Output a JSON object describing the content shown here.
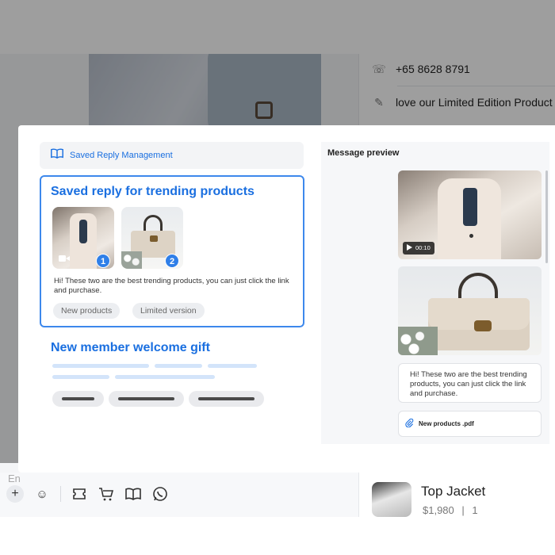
{
  "background": {
    "contact": {
      "phone": "+65 8628 8791",
      "note": "love our Limited Edition Product"
    },
    "input_placeholder": "En",
    "toolbar_icons": [
      "plus-icon",
      "emoji-icon",
      "ticket-icon",
      "cart-icon",
      "book-icon",
      "whatsapp-icon"
    ],
    "product": {
      "name": "Top Jacket",
      "price": "$1,980",
      "separator": "|",
      "quantity": "1"
    }
  },
  "modal": {
    "header": {
      "title": "Saved Reply Management"
    },
    "saved_reply": {
      "title": "Saved reply for trending products",
      "attachments": [
        {
          "type": "video",
          "badge": "1"
        },
        {
          "type": "image",
          "badge": "2"
        }
      ],
      "text": "Hi! These two are the best trending products, you can just click the link and purchase.",
      "tags": [
        "New products",
        "Limited version"
      ]
    },
    "second_reply": {
      "title": "New member welcome gift"
    },
    "preview": {
      "title": "Message preview",
      "video_duration": "00:10",
      "message_text": "Hi! These two are the best trending products, you can just click the link and purchase.",
      "file_name": "New products .pdf"
    }
  },
  "colors": {
    "accent": "#1a6fe0",
    "selected_border": "#3d88ec",
    "badge": "#2f7fe8",
    "overlay": "rgba(0,0,0,0.38)"
  }
}
